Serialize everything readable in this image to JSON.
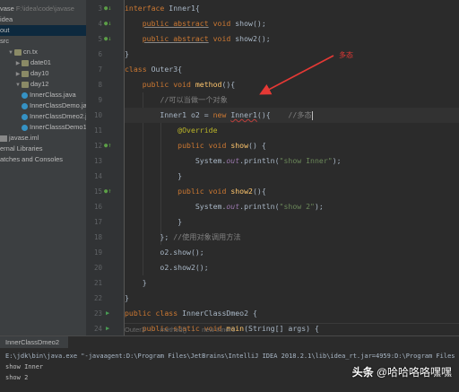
{
  "project_tree": [
    {
      "label": "vase",
      "sub": " F:\\idea\\code\\javase",
      "indent": 0,
      "glyph": "",
      "icon": ""
    },
    {
      "label": "idea",
      "indent": 0,
      "glyph": "",
      "icon": ""
    },
    {
      "label": "out",
      "indent": 0,
      "glyph": "",
      "icon": "",
      "highlight": true
    },
    {
      "label": "src",
      "indent": 0,
      "glyph": "",
      "icon": ""
    },
    {
      "label": "cn.tx",
      "indent": 1,
      "glyph": "▼",
      "icon": "folder"
    },
    {
      "label": "date01",
      "indent": 2,
      "glyph": "▶",
      "icon": "folder"
    },
    {
      "label": "day10",
      "indent": 2,
      "glyph": "▶",
      "icon": "folder"
    },
    {
      "label": "day12",
      "indent": 2,
      "glyph": "▼",
      "icon": "folder"
    },
    {
      "label": "InnerClass.java",
      "indent": 3,
      "glyph": "",
      "icon": "cls"
    },
    {
      "label": "InnerClassDemo.ja",
      "indent": 3,
      "glyph": "",
      "icon": "cls"
    },
    {
      "label": "InnerClassDmeo2.j",
      "indent": 3,
      "glyph": "",
      "icon": "cls"
    },
    {
      "label": "InnerClasssDemo1",
      "indent": 3,
      "glyph": "",
      "icon": "cls"
    },
    {
      "label": "javase.iml",
      "indent": 0,
      "glyph": "",
      "icon": "iml"
    },
    {
      "label": "ernal Libraries",
      "indent": 0,
      "glyph": "",
      "icon": ""
    },
    {
      "label": "atches and Consoles",
      "indent": 0,
      "glyph": "",
      "icon": ""
    }
  ],
  "line_numbers": [
    "3",
    "4",
    "5",
    "6",
    "7",
    "8",
    "9",
    "10",
    "11",
    "12",
    "13",
    "14",
    "15",
    "16",
    "17",
    "18",
    "19",
    "20",
    "21",
    "22",
    "23",
    "24",
    "25",
    "26",
    "27"
  ],
  "code_lines": [
    [
      {
        "t": "interface ",
        "c": "kw"
      },
      {
        "t": "Inner1",
        "c": ""
      },
      {
        "t": "{",
        "c": ""
      }
    ],
    [
      {
        "t": "    ",
        "c": ""
      },
      {
        "t": "public abstract",
        "c": "abs"
      },
      {
        "t": " ",
        "c": ""
      },
      {
        "t": "void",
        "c": "kw"
      },
      {
        "t": " show();",
        "c": ""
      }
    ],
    [
      {
        "t": "    ",
        "c": ""
      },
      {
        "t": "public abstract",
        "c": "abs"
      },
      {
        "t": " ",
        "c": ""
      },
      {
        "t": "void",
        "c": "kw"
      },
      {
        "t": " show2();",
        "c": ""
      }
    ],
    [
      {
        "t": "}",
        "c": ""
      }
    ],
    [
      {
        "t": "class ",
        "c": "kw"
      },
      {
        "t": "Outer3",
        "c": ""
      },
      {
        "t": "{",
        "c": ""
      }
    ],
    [
      {
        "t": "    ",
        "c": ""
      },
      {
        "t": "public void ",
        "c": "kw"
      },
      {
        "t": "method",
        "c": "fn"
      },
      {
        "t": "(){",
        "c": ""
      }
    ],
    [
      {
        "t": "        ",
        "c": ""
      },
      {
        "t": "//可以当做一个对象",
        "c": "cmt"
      }
    ],
    [
      {
        "t": "        Inner1 o2 = ",
        "c": ""
      },
      {
        "t": "new ",
        "c": "kw"
      },
      {
        "t": "Inner1",
        "c": "err"
      },
      {
        "t": "(){  ",
        "c": ""
      },
      {
        "t": "  //多态",
        "c": "cmt"
      },
      {
        "t": "",
        "c": "caret"
      }
    ],
    [
      {
        "t": "            ",
        "c": ""
      },
      {
        "t": "@Override",
        "c": "ann"
      }
    ],
    [
      {
        "t": "            ",
        "c": ""
      },
      {
        "t": "public void ",
        "c": "kw"
      },
      {
        "t": "show",
        "c": "fn"
      },
      {
        "t": "() {",
        "c": ""
      }
    ],
    [
      {
        "t": "                System.",
        "c": ""
      },
      {
        "t": "out",
        "c": "fld"
      },
      {
        "t": ".println(",
        "c": ""
      },
      {
        "t": "\"show Inner\"",
        "c": "str"
      },
      {
        "t": ");",
        "c": ""
      }
    ],
    [
      {
        "t": "            }",
        "c": ""
      }
    ],
    [
      {
        "t": "            ",
        "c": ""
      },
      {
        "t": "public void ",
        "c": "kw"
      },
      {
        "t": "show2",
        "c": "fn"
      },
      {
        "t": "(){",
        "c": ""
      }
    ],
    [
      {
        "t": "                System.",
        "c": ""
      },
      {
        "t": "out",
        "c": "fld"
      },
      {
        "t": ".println(",
        "c": ""
      },
      {
        "t": "\"show 2\"",
        "c": "str"
      },
      {
        "t": ");",
        "c": ""
      }
    ],
    [
      {
        "t": "            }",
        "c": ""
      }
    ],
    [
      {
        "t": "        }; ",
        "c": ""
      },
      {
        "t": "//使用对象调用方法",
        "c": "cmt"
      }
    ],
    [
      {
        "t": "        o2.show();",
        "c": ""
      }
    ],
    [
      {
        "t": "        o2.show2();",
        "c": ""
      }
    ],
    [
      {
        "t": "    }",
        "c": ""
      }
    ],
    [
      {
        "t": "}",
        "c": ""
      }
    ],
    [
      {
        "t": "public class ",
        "c": "kw"
      },
      {
        "t": "InnerClassDmeo2",
        "c": ""
      },
      {
        "t": " {",
        "c": ""
      }
    ],
    [
      {
        "t": "    ",
        "c": ""
      },
      {
        "t": "public static void ",
        "c": "kw"
      },
      {
        "t": "main",
        "c": "fn"
      },
      {
        "t": "(String[] args) {",
        "c": ""
      }
    ],
    [
      {
        "t": "        Outer3 o = ",
        "c": ""
      },
      {
        "t": "new ",
        "c": "kw"
      },
      {
        "t": "Outer3();",
        "c": ""
      }
    ],
    [
      {
        "t": "        o.method();",
        "c": ""
      }
    ],
    [
      {
        "t": "    }",
        "c": ""
      }
    ]
  ],
  "gutter_marks": [
    {
      "line": 0,
      "kind": "impl",
      "glyph": "●↓"
    },
    {
      "line": 1,
      "kind": "impl",
      "glyph": "●↓"
    },
    {
      "line": 2,
      "kind": "impl",
      "glyph": "●↓"
    },
    {
      "line": 9,
      "kind": "impl",
      "glyph": "●↑"
    },
    {
      "line": 12,
      "kind": "impl",
      "glyph": "●↑"
    },
    {
      "line": 20,
      "kind": "run",
      "glyph": "▶"
    },
    {
      "line": 21,
      "kind": "run",
      "glyph": "▶"
    }
  ],
  "current_line": 7,
  "breadcrumb": [
    "Outer3",
    "method()",
    "new Inner1"
  ],
  "annotation_label": "多态",
  "run": {
    "tab_label": "InnerClassDmeo2",
    "command": "E:\\jdk\\bin\\java.exe \"-javaagent:D:\\Program Files\\JetBrains\\IntelliJ IDEA 2018.2.1\\lib\\idea_rt.jar=4959:D:\\Program Files\\JetBrains\\IntelliJ IDEA",
    "output": [
      "show Inner",
      "show 2"
    ]
  },
  "watermark": {
    "logo": "头条",
    "handle": "@哈哈咯咯嘿嘿"
  },
  "colors": {
    "keyword": "#cc7832",
    "string": "#6a8759",
    "comment": "#808080",
    "annotation": "#bbb529",
    "arrow": "#e53935"
  }
}
